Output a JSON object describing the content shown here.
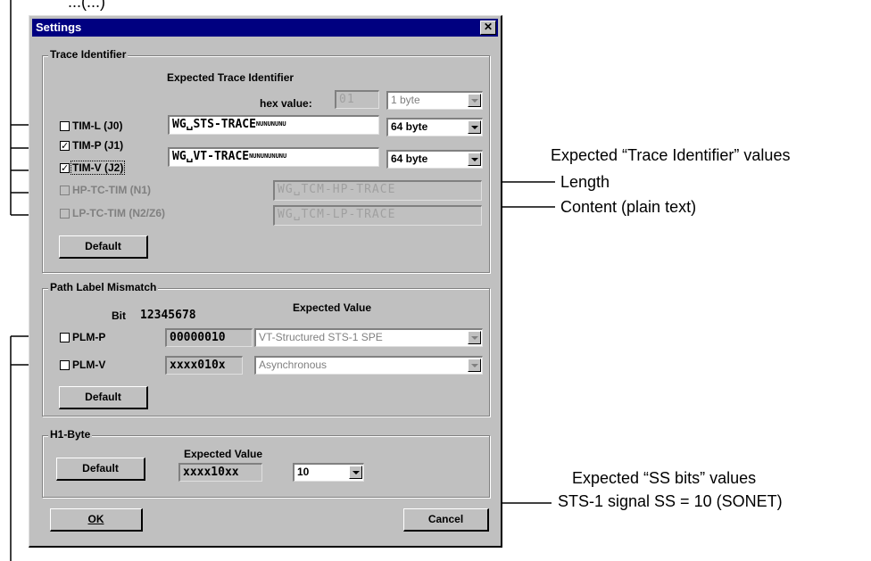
{
  "top_caption": "...(...)",
  "dialog": {
    "title": "Settings",
    "close_glyph": "✕",
    "ok_label": "OK",
    "cancel_label": "Cancel"
  },
  "trace": {
    "group_title": "Trace Identifier",
    "heading": "Expected Trace Identifier",
    "hex_label": "hex value:",
    "hex_value": "01",
    "default_label": "Default",
    "rows": [
      {
        "label": "TIM-L (J0)",
        "checked": false,
        "enabled": true,
        "field": "",
        "combo": "1 byte"
      },
      {
        "label": "TIM-P (J1)",
        "checked": true,
        "enabled": true,
        "field": "WG␣STS-TRACE",
        "nulls": "NUNUNUNU",
        "combo": "64 byte"
      },
      {
        "label": "TIM-V (J2)",
        "checked": true,
        "enabled": true,
        "field": "WG␣VT-TRACE",
        "nulls": "NUNUNUNUNU",
        "combo": "64 byte"
      },
      {
        "label": "HP-TC-TIM (N1)",
        "checked": false,
        "enabled": false,
        "field": "WG␣TCM-HP-TRACE"
      },
      {
        "label": "LP-TC-TIM (N2/Z6)",
        "checked": false,
        "enabled": false,
        "field": "WG␣TCM-LP-TRACE"
      }
    ]
  },
  "plm": {
    "group_title": "Path Label Mismatch",
    "bit_label": "Bit",
    "bit_numbers": "12345678",
    "heading": "Expected Value",
    "default_label": "Default",
    "rows": [
      {
        "label": "PLM-P",
        "checked": false,
        "bits": "00000010",
        "value": "VT-Structured STS-1 SPE"
      },
      {
        "label": "PLM-V",
        "checked": false,
        "bits": "xxxx010x",
        "value": "Asynchronous"
      }
    ]
  },
  "h1": {
    "group_title": "H1-Byte",
    "heading": "Expected Value",
    "default_label": "Default",
    "bits": "xxxx10xx",
    "combo": "10"
  },
  "annotations": {
    "trace_title": "Expected “Trace Identifier” values",
    "length": "Length",
    "content": "Content (plain text)",
    "ss_title": "Expected “SS bits” values",
    "ss_desc": "STS-1 signal SS = 10 (SONET)"
  },
  "colors": {
    "dialog_bg": "#c0c0c0",
    "titlebar": "#000080",
    "disabled_text": "#808080"
  }
}
